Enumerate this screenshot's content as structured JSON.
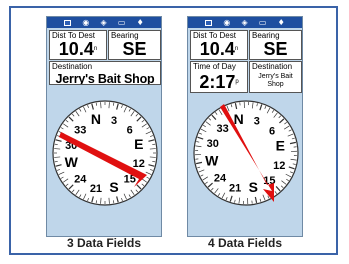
{
  "panels": [
    {
      "caption": "3 Data Fields",
      "status_icons": [
        "battery-icon",
        "satellite-icon",
        "gps-icon",
        "map-icon",
        "backlight-icon"
      ],
      "fields": [
        {
          "label": "Dist To Dest",
          "value": "10.4",
          "unit": "n"
        },
        {
          "label": "Bearing",
          "value": "SE"
        },
        {
          "label": "Destination",
          "value": "Jerry's Bait Shop"
        }
      ],
      "compass": {
        "labels": [
          "N",
          "3",
          "6",
          "E",
          "12",
          "15",
          "S",
          "21",
          "24",
          "W",
          "30",
          "33"
        ],
        "pointer_to": "SE"
      }
    },
    {
      "caption": "4 Data Fields",
      "status_icons": [
        "battery-icon",
        "satellite-icon",
        "gps-icon",
        "map-icon",
        "backlight-icon"
      ],
      "fields": [
        {
          "label": "Dist To Dest",
          "value": "10.4",
          "unit": "n"
        },
        {
          "label": "Bearing",
          "value": "SE"
        },
        {
          "label": "Time of Day",
          "value": "2:17",
          "unit": "p"
        },
        {
          "label": "Destination",
          "value": "Jerry's Bait Shop"
        }
      ],
      "compass": {
        "labels": [
          "N",
          "3",
          "6",
          "E",
          "12",
          "15",
          "S",
          "21",
          "24",
          "W",
          "30",
          "33"
        ],
        "pointer_to": "SE"
      }
    }
  ],
  "colors": {
    "frame": "#3a63a8",
    "screen_bg": "#bfd6ea",
    "status_bar": "#1e4fa0",
    "pointer": "#e01010"
  }
}
